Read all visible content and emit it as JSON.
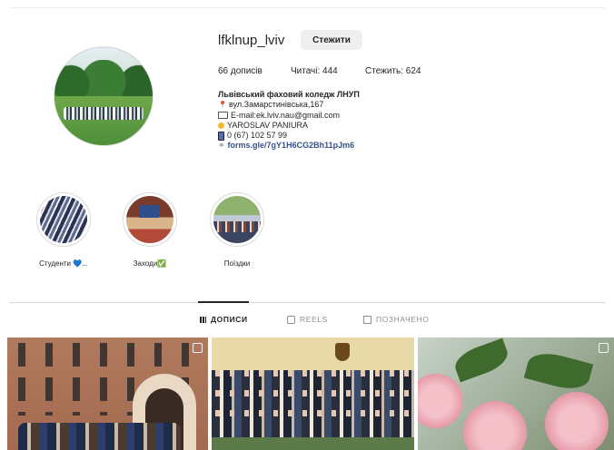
{
  "profile": {
    "username": "lfklnup_lviv",
    "follow_label": "Стежити",
    "stats": {
      "posts": "66 дописів",
      "followers": "Читачі: 444",
      "following": "Стежить: 624"
    },
    "bio": {
      "name": "Львівський фаховий коледж ЛНУП",
      "address": "вул.Замарстинівська,167",
      "email": "E-mail:ek.lviv.nau@gmail.com",
      "contact_person": "YAROSLAV PANIURA",
      "phone": "0 (67) 102 57 99",
      "link": "forms.gle/7gY1H6CG2Bh11pJm6"
    }
  },
  "highlights": [
    {
      "label": "Студенти 💙..."
    },
    {
      "label": "Заходи✅"
    },
    {
      "label": "Поїздки"
    }
  ],
  "tabs": [
    {
      "label": "ДОПИСИ",
      "active": true,
      "icon": "grid-icon"
    },
    {
      "label": "REELS",
      "active": false,
      "icon": "reels-icon"
    },
    {
      "label": "ПОЗНАЧЕНО",
      "active": false,
      "icon": "tagged-icon"
    }
  ],
  "colors": {
    "link": "#385185",
    "tab_active": "#262626",
    "tab_inactive": "#8e8e8e",
    "button_bg": "#efefef"
  }
}
